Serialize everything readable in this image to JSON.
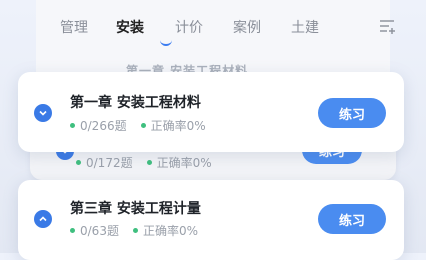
{
  "tabs": [
    {
      "label": "管理"
    },
    {
      "label": "安装"
    },
    {
      "label": "计价"
    },
    {
      "label": "案例"
    },
    {
      "label": "土建"
    }
  ],
  "ghost_title": "第一章 安装工程材料",
  "chapters": [
    {
      "title": "第一章 安装工程材料",
      "questions": "0/266题",
      "accuracy": "正确率0%",
      "button": "练习"
    },
    {
      "title": "",
      "questions": "0/172题",
      "accuracy": "正确率0%",
      "button": "练习"
    },
    {
      "title": "第三章 安装工程计量",
      "questions": "0/63题",
      "accuracy": "正确率0%",
      "button": "练习"
    }
  ],
  "colors": {
    "accent": "#3a7ae6",
    "button": "#4a8cf0",
    "dot": "#3fbf7f"
  }
}
